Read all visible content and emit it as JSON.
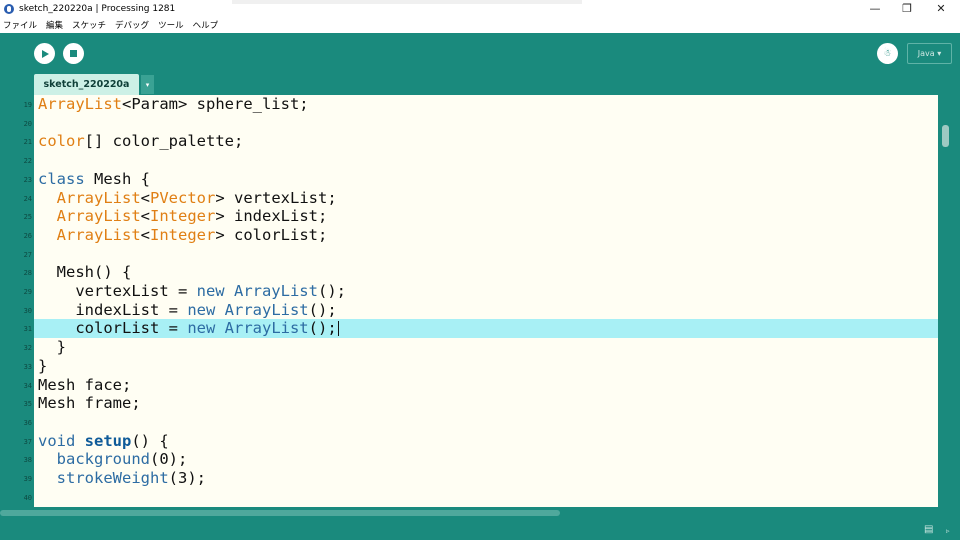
{
  "window": {
    "title": "sketch_220220a | Processing 1281",
    "minimize": "—",
    "maximize": "❐",
    "close": "✕"
  },
  "menu": [
    "ファイル",
    "編集",
    "スケッチ",
    "デバッグ",
    "ツール",
    "ヘルプ"
  ],
  "toolbar": {
    "run_icon": "play-icon",
    "stop_icon": "stop-icon",
    "debug_icon": "debug-icon",
    "debug_label": "☃",
    "mode": "Java ▾"
  },
  "tabs": {
    "active": "sketch_220220a",
    "menu_arrow": "▾"
  },
  "editor": {
    "current_line": 31,
    "lines": [
      {
        "no": 19,
        "parts": [
          [
            "type",
            "ArrayList"
          ],
          [
            "",
            "<Param> sphere_list;"
          ]
        ]
      },
      {
        "no": 20,
        "parts": []
      },
      {
        "no": 21,
        "parts": [
          [
            "type",
            "color"
          ],
          [
            "",
            "[] color_palette;"
          ]
        ]
      },
      {
        "no": 22,
        "parts": []
      },
      {
        "no": 23,
        "parts": [
          [
            "kw",
            "class"
          ],
          [
            "",
            " Mesh {"
          ]
        ]
      },
      {
        "no": 24,
        "parts": [
          [
            "",
            "  "
          ],
          [
            "type",
            "ArrayList"
          ],
          [
            "",
            "<"
          ],
          [
            "type",
            "PVector"
          ],
          [
            "",
            "> vertexList;"
          ]
        ]
      },
      {
        "no": 25,
        "parts": [
          [
            "",
            "  "
          ],
          [
            "type",
            "ArrayList"
          ],
          [
            "",
            "<"
          ],
          [
            "type",
            "Integer"
          ],
          [
            "",
            "> indexList;"
          ]
        ]
      },
      {
        "no": 26,
        "parts": [
          [
            "",
            "  "
          ],
          [
            "type",
            "ArrayList"
          ],
          [
            "",
            "<"
          ],
          [
            "type",
            "Integer"
          ],
          [
            "",
            "> colorList;"
          ]
        ]
      },
      {
        "no": 27,
        "parts": []
      },
      {
        "no": 28,
        "parts": [
          [
            "",
            "  Mesh() {"
          ]
        ]
      },
      {
        "no": 29,
        "parts": [
          [
            "",
            "    vertexList = "
          ],
          [
            "kw",
            "new"
          ],
          [
            "",
            " "
          ],
          [
            "kw",
            "ArrayList"
          ],
          [
            "",
            "();"
          ]
        ]
      },
      {
        "no": 30,
        "parts": [
          [
            "",
            "    indexList = "
          ],
          [
            "kw",
            "new"
          ],
          [
            "",
            " "
          ],
          [
            "kw",
            "ArrayList"
          ],
          [
            "",
            "();"
          ]
        ]
      },
      {
        "no": 31,
        "parts": [
          [
            "",
            "    colorList = "
          ],
          [
            "kw",
            "new"
          ],
          [
            "",
            " "
          ],
          [
            "kw",
            "ArrayList"
          ],
          [
            "",
            "();"
          ]
        ]
      },
      {
        "no": 32,
        "parts": [
          [
            "",
            "  }"
          ]
        ]
      },
      {
        "no": 33,
        "parts": [
          [
            "",
            "}"
          ]
        ]
      },
      {
        "no": 34,
        "parts": [
          [
            "",
            "Mesh face;"
          ]
        ]
      },
      {
        "no": 35,
        "parts": [
          [
            "",
            "Mesh frame;"
          ]
        ]
      },
      {
        "no": 36,
        "parts": []
      },
      {
        "no": 37,
        "parts": [
          [
            "kw",
            "void"
          ],
          [
            "",
            " "
          ],
          [
            "kwb",
            "setup"
          ],
          [
            "",
            "() {"
          ]
        ]
      },
      {
        "no": 38,
        "parts": [
          [
            "",
            "  "
          ],
          [
            "kw",
            "background"
          ],
          [
            "",
            "(0);"
          ]
        ]
      },
      {
        "no": 39,
        "parts": [
          [
            "",
            "  "
          ],
          [
            "kw",
            "strokeWeight"
          ],
          [
            "",
            "(3);"
          ]
        ]
      },
      {
        "no": 40,
        "parts": []
      }
    ]
  },
  "status": {
    "console_icon": "console-icon",
    "console_glyph": "▤",
    "expand_glyph": "▹"
  },
  "colors": {
    "chrome": "#1a8a7d",
    "editor_bg": "#fffef3",
    "current_line": "#a8f0f5",
    "keyword": "#2d6ca3",
    "type": "#e07f14"
  }
}
